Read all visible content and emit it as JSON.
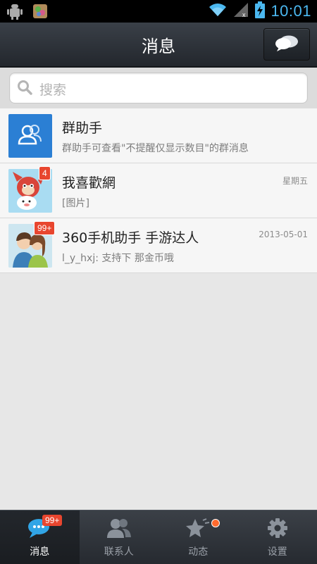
{
  "status_bar": {
    "time": "10:01",
    "icons": [
      "android-debug-icon",
      "photos-app-icon",
      "wifi-icon",
      "signal-icon",
      "battery-charging-icon"
    ]
  },
  "header": {
    "title": "消息",
    "action_icon": "chat-bubbles-icon"
  },
  "search": {
    "placeholder": "搜索",
    "icon": "search-icon"
  },
  "conversations": [
    {
      "name": "群助手",
      "preview": "群助手可查看\"不提醒仅显示数目\"的群消息",
      "time": "",
      "badge": "",
      "avatar": "group-helper-icon"
    },
    {
      "name": "我喜歡網",
      "preview": "[图片]",
      "time": "星期五",
      "badge": "4",
      "avatar": "cartoon-avatar"
    },
    {
      "name": "360手机助手 手游达人",
      "preview": "l_y_hxj: 支持下  那金币哦",
      "time": "2013-05-01",
      "badge": "99+",
      "avatar": "couple-avatar"
    }
  ],
  "tabs": [
    {
      "label": "消息",
      "icon": "message-bubble-icon",
      "badge": "99+",
      "active": true
    },
    {
      "label": "联系人",
      "icon": "contacts-icon",
      "badge": "",
      "active": false
    },
    {
      "label": "动态",
      "icon": "star-feed-icon",
      "badge": "",
      "active": false
    },
    {
      "label": "设置",
      "icon": "gear-icon",
      "badge": "",
      "active": false
    }
  ],
  "colors": {
    "accent_blue": "#4bb8f0",
    "badge_red": "#e8462f",
    "header_dark": "#2c3036",
    "notification_dot": "#ff6a2e"
  }
}
